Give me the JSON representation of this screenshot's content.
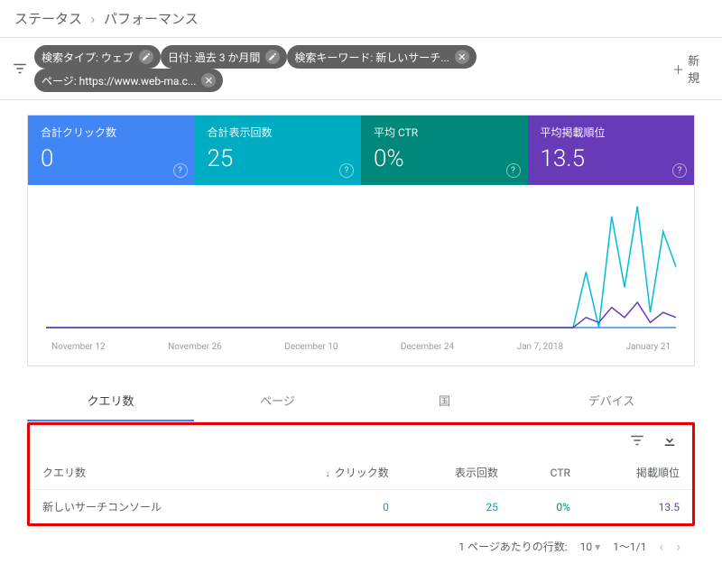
{
  "breadcrumb": {
    "parent": "ステータス",
    "current": "パフォーマンス"
  },
  "filters": {
    "chips": [
      {
        "label": "検索タイプ: ウェブ",
        "action": "edit"
      },
      {
        "label": "日付: 過去 3 か月間",
        "action": "edit"
      },
      {
        "label": "検索キーワード: 新しいサーチ...",
        "action": "close"
      },
      {
        "label": "ページ: https://www.web-ma.c...",
        "action": "close"
      }
    ],
    "add_label": "新規"
  },
  "metrics": [
    {
      "title": "合計クリック数",
      "value": "0"
    },
    {
      "title": "合計表示回数",
      "value": "25"
    },
    {
      "title": "平均 CTR",
      "value": "0%"
    },
    {
      "title": "平均掲載順位",
      "value": "13.5"
    }
  ],
  "chart_data": {
    "type": "line",
    "xlabels": [
      "November 12",
      "November 26",
      "December 10",
      "December 24",
      "Jan 7, 2018",
      "January 21"
    ],
    "ylim": [
      0,
      25
    ],
    "series": [
      {
        "name": "クリック数",
        "color": "#4285f4",
        "values": [
          0,
          0,
          0,
          0,
          0,
          0,
          0,
          0,
          0,
          0,
          0,
          0,
          0,
          0,
          0,
          0,
          0,
          0,
          0,
          0,
          0,
          0,
          0,
          0,
          0,
          0,
          0,
          0,
          0,
          0,
          0,
          0,
          0,
          0,
          0,
          0,
          0,
          0,
          0,
          0,
          0,
          0,
          0,
          0,
          0,
          0,
          0,
          0,
          0,
          0
        ]
      },
      {
        "name": "表示回数",
        "color": "#00bcd4",
        "values": [
          0,
          0,
          0,
          0,
          0,
          0,
          0,
          0,
          0,
          0,
          0,
          0,
          0,
          0,
          0,
          0,
          0,
          0,
          0,
          0,
          0,
          0,
          0,
          0,
          0,
          0,
          0,
          0,
          0,
          0,
          0,
          0,
          0,
          0,
          0,
          0,
          0,
          0,
          0,
          0,
          0,
          0,
          11,
          0,
          22,
          8,
          24,
          3,
          19,
          12
        ]
      },
      {
        "name": "掲載順位",
        "color": "#673ab7",
        "values": [
          0,
          0,
          0,
          0,
          0,
          0,
          0,
          0,
          0,
          0,
          0,
          0,
          0,
          0,
          0,
          0,
          0,
          0,
          0,
          0,
          0,
          0,
          0,
          0,
          0,
          0,
          0,
          0,
          0,
          0,
          0,
          0,
          0,
          0,
          0,
          0,
          0,
          0,
          0,
          0,
          0,
          0,
          2,
          1,
          4,
          2,
          5,
          1,
          3,
          2
        ]
      }
    ]
  },
  "tabs": [
    "クエリ数",
    "ページ",
    "国",
    "デバイス"
  ],
  "active_tab": 0,
  "table": {
    "columns": [
      "クエリ数",
      "クリック数",
      "表示回数",
      "CTR",
      "掲載順位"
    ],
    "sort_col": 1,
    "rows": [
      {
        "query": "新しいサーチコンソール",
        "clicks": "0",
        "impressions": "25",
        "ctr": "0%",
        "position": "13.5"
      }
    ]
  },
  "pager": {
    "rows_label": "1 ページあたりの行数:",
    "rows_value": "10",
    "range": "1～1/1"
  }
}
